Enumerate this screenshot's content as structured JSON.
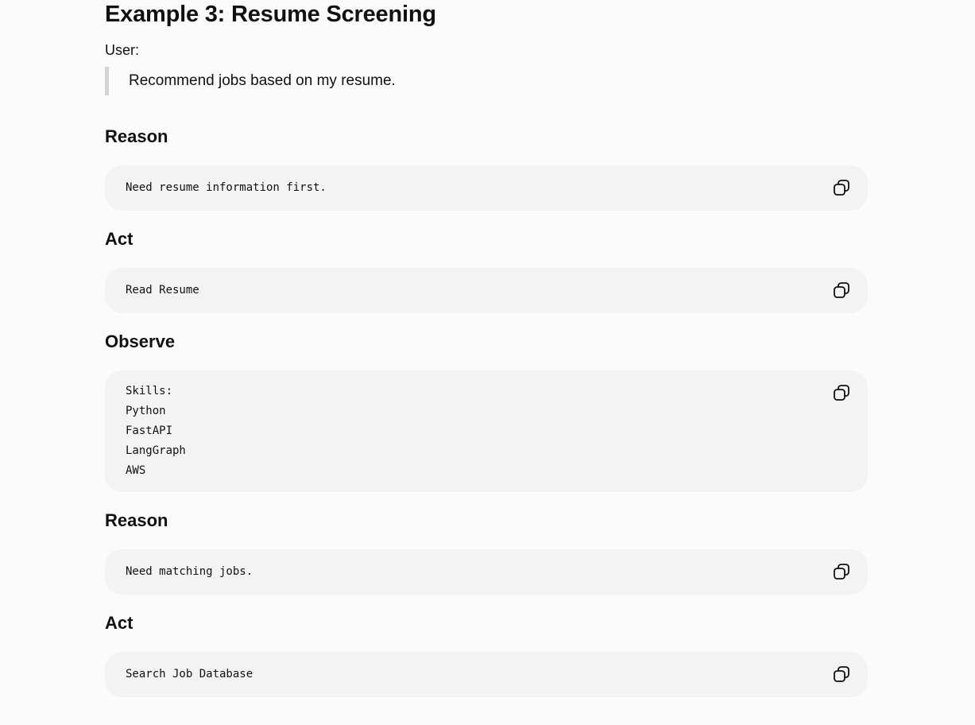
{
  "title": "Example 3: Resume Screening",
  "user_label": "User:",
  "user_quote": "Recommend jobs based on my resume.",
  "steps": [
    {
      "heading": "Reason",
      "lines": [
        "Need resume information first."
      ]
    },
    {
      "heading": "Act",
      "lines": [
        "Read Resume"
      ]
    },
    {
      "heading": "Observe",
      "lines": [
        "Skills:",
        "Python",
        "FastAPI",
        "LangGraph",
        "AWS"
      ]
    },
    {
      "heading": "Reason",
      "lines": [
        "Need matching jobs."
      ]
    },
    {
      "heading": "Act",
      "lines": [
        "Search Job Database"
      ]
    }
  ],
  "icons": {
    "copy": "copy-icon"
  },
  "colors": {
    "background": "#fbfbfb",
    "code_background": "#f3f3f3",
    "quote_border": "#d4d4d4",
    "text": "#111111"
  }
}
